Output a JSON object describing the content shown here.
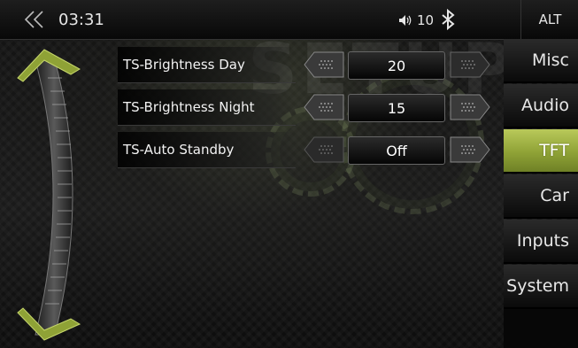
{
  "status": {
    "time": "03:31",
    "volume": "10",
    "alt_label": "ALT"
  },
  "watermark": "SETUP",
  "settings": [
    {
      "label": "TS-Brightness Day",
      "value": "20"
    },
    {
      "label": "TS-Brightness Night",
      "value": "15"
    },
    {
      "label": "TS-Auto Standby",
      "value": "Off"
    }
  ],
  "tabs": [
    {
      "label": "Misc",
      "active": false
    },
    {
      "label": "Audio",
      "active": false
    },
    {
      "label": "TFT",
      "active": true
    },
    {
      "label": "Car",
      "active": false
    },
    {
      "label": "Inputs",
      "active": false
    },
    {
      "label": "System",
      "active": false
    }
  ],
  "colors": {
    "accent_green": "#9db23e",
    "background": "#111111"
  },
  "icons": [
    "back-chevrons-icon",
    "volume-icon",
    "bluetooth-icon",
    "scroll-up-arrow-icon",
    "scroll-down-arrow-icon",
    "decrease-arrow-icon",
    "increase-arrow-icon"
  ]
}
